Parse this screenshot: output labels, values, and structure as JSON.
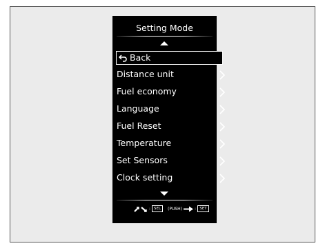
{
  "screen": {
    "title": "Setting Mode",
    "back_label": "Back",
    "items": [
      {
        "label": "Distance unit"
      },
      {
        "label": "Fuel economy"
      },
      {
        "label": "Language"
      },
      {
        "label": "Fuel Reset"
      },
      {
        "label": "Temperature"
      },
      {
        "label": "Set Sensors"
      },
      {
        "label": "Clock setting"
      }
    ]
  },
  "legend": {
    "colon_1": ":",
    "sel_label": "SEL",
    "push_label": "(PUSH)",
    "colon_2": ":",
    "set_label": "SET"
  },
  "icons": {
    "up": "arrow-up-icon",
    "down": "arrow-down-icon",
    "back": "back-arrow-icon",
    "chevron": "chevron-right-icon",
    "rotate": "rotate-knob-icon",
    "push": "push-arrow-icon"
  }
}
